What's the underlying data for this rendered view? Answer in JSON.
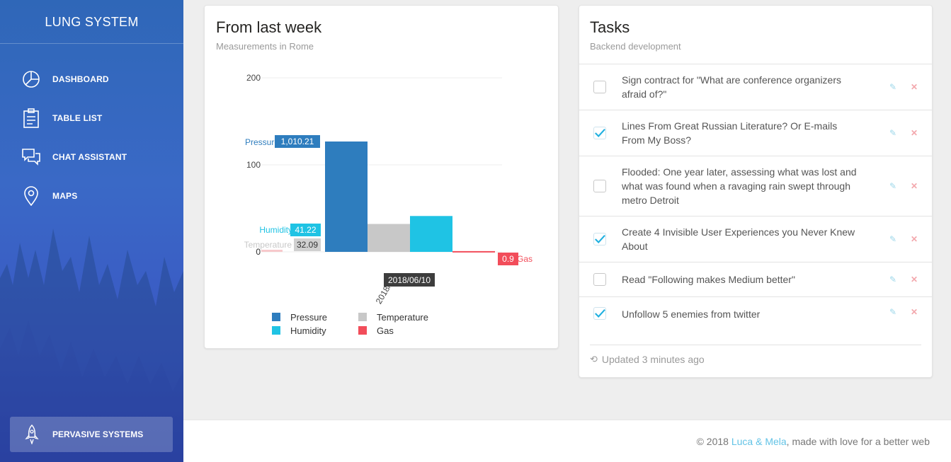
{
  "app": {
    "brand": "LUNG SYSTEM"
  },
  "sidebar": {
    "items": [
      {
        "label": "DASHBOARD",
        "icon": "pie-chart-icon"
      },
      {
        "label": "TABLE LIST",
        "icon": "clipboard-icon"
      },
      {
        "label": "CHAT ASSISTANT",
        "icon": "chat-icon"
      },
      {
        "label": "MAPS",
        "icon": "map-pin-icon"
      }
    ],
    "promo": {
      "label": "PERVASIVE SYSTEMS",
      "icon": "rocket-icon"
    }
  },
  "chart_card": {
    "title": "From last week",
    "subtitle": "Measurements in Rome"
  },
  "chart_data": {
    "type": "bar",
    "categories": [
      "2018/06/10"
    ],
    "category_axis_label_visible": "2018/06",
    "series": [
      {
        "name": "Pressure",
        "values": [
          1010.21
        ],
        "color": "#2e7dbe",
        "tooltip": "1,010.21"
      },
      {
        "name": "Temperature",
        "values": [
          32.09
        ],
        "color": "#c8c8c8",
        "tooltip": "32.09"
      },
      {
        "name": "Humidity",
        "values": [
          41.22
        ],
        "color": "#1fc3e4",
        "tooltip": "41.22"
      },
      {
        "name": "Gas",
        "values": [
          0.9
        ],
        "color": "#f24d5a",
        "tooltip": "0.9"
      }
    ],
    "y_ticks": [
      "0",
      "100",
      "200",
      "300"
    ],
    "ylim": [
      0,
      400
    ],
    "hover_label": "2018/06/10",
    "legend": [
      "Pressure",
      "Temperature",
      "Humidity",
      "Gas"
    ],
    "legend_position": "bottom",
    "grid": true
  },
  "tasks_card": {
    "title": "Tasks",
    "subtitle": "Backend development",
    "tasks": [
      {
        "text": "Sign contract for \"What are conference organizers afraid of?\"",
        "checked": false
      },
      {
        "text": "Lines From Great Russian Literature? Or E-mails From My Boss?",
        "checked": true
      },
      {
        "text": "Flooded: One year later, assessing what was lost and what was found when a ravaging rain swept through metro Detroit",
        "checked": false
      },
      {
        "text": "Create 4 Invisible User Experiences you Never Knew About",
        "checked": true
      },
      {
        "text": "Read \"Following makes Medium better\"",
        "checked": false
      },
      {
        "text": "Unfollow 5 enemies from twitter",
        "checked": true
      }
    ],
    "footer": "Updated 3 minutes ago"
  },
  "footer": {
    "prefix": "© 2018 ",
    "link": "Luca & Mela",
    "suffix": ", made with love for a better web"
  }
}
